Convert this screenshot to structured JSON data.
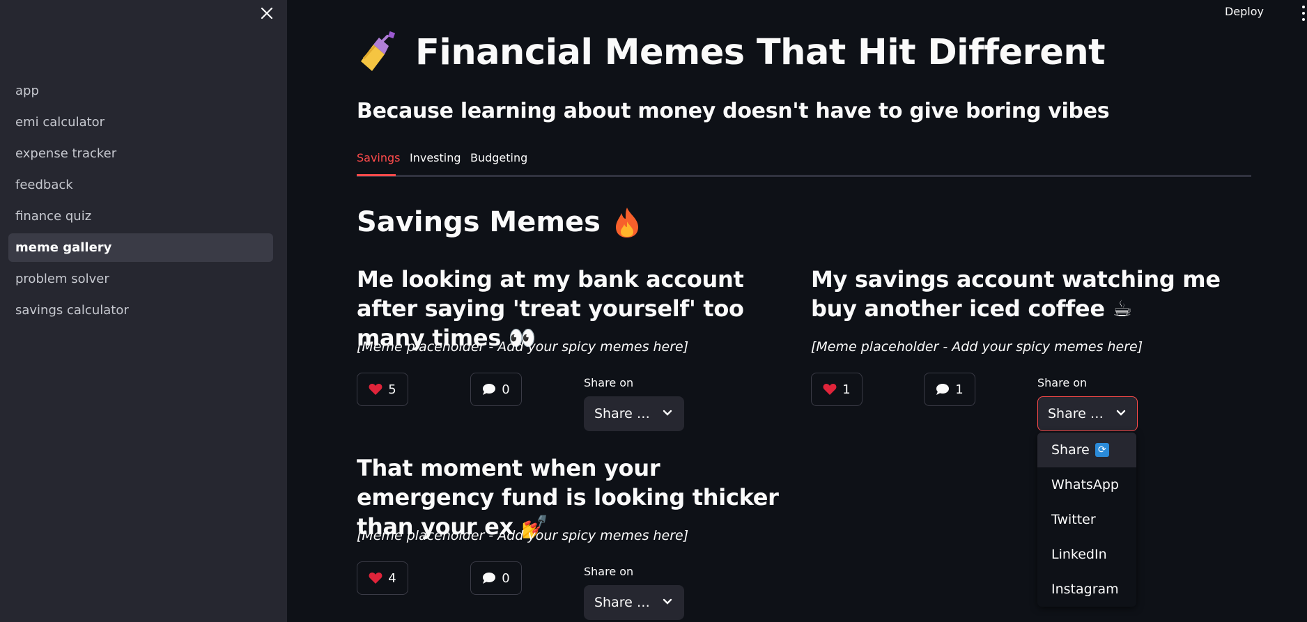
{
  "sidebar": {
    "nav_items": [
      {
        "label": "app"
      },
      {
        "label": "emi calculator"
      },
      {
        "label": "expense tracker"
      },
      {
        "label": "feedback"
      },
      {
        "label": "finance quiz"
      },
      {
        "label": "meme gallery",
        "active": true
      },
      {
        "label": "problem solver"
      },
      {
        "label": "savings calculator"
      }
    ]
  },
  "topbar": {
    "deploy_label": "Deploy"
  },
  "header": {
    "title": "Financial Memes That Hit Different",
    "subtitle": "Because learning about money doesn't have to give boring vibes"
  },
  "tabs": [
    {
      "label": "Savings",
      "active": true
    },
    {
      "label": "Investing"
    },
    {
      "label": "Budgeting"
    }
  ],
  "section": {
    "title": "Savings Memes"
  },
  "memes": [
    {
      "title": "Me looking at my bank account after saying 'treat yourself' too many times 👀",
      "placeholder": "[Meme placeholder - Add your spicy memes here]",
      "likes": "5",
      "comments": "0",
      "share_label": "Share on",
      "share_value": "Share …"
    },
    {
      "title": "My savings account watching me buy another iced coffee ☕",
      "placeholder": "[Meme placeholder - Add your spicy memes here]",
      "likes": "1",
      "comments": "1",
      "share_label": "Share on",
      "share_value": "Share …"
    },
    {
      "title": "That moment when your emergency fund is looking thicker than your ex 💅",
      "placeholder": "[Meme placeholder - Add your spicy memes here]",
      "likes": "4",
      "comments": "0",
      "share_label": "Share on",
      "share_value": "Share …"
    }
  ],
  "share_dropdown": {
    "options": [
      "Share",
      "WhatsApp",
      "Twitter",
      "LinkedIn",
      "Instagram"
    ],
    "selected": "Share"
  },
  "colors": {
    "accent": "#ff4b4b",
    "background": "#0e1117",
    "sidebar": "#262730"
  },
  "icons": [
    "close-icon",
    "nail-polish-icon",
    "fire-icon",
    "heart-icon",
    "speech-bubble-icon",
    "chevron-down-icon",
    "recycle-icon",
    "more-vert-icon"
  ]
}
